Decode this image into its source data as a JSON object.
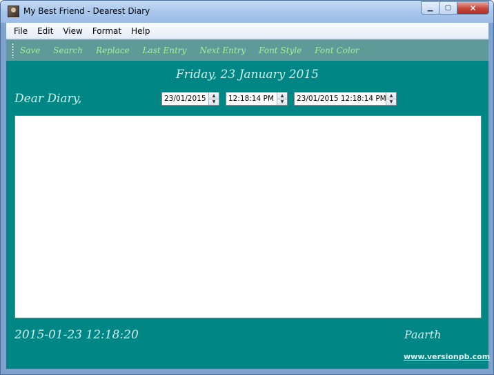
{
  "window": {
    "title": "My Best Friend - Dearest Diary",
    "controls": {
      "minimize": "▁",
      "maximize": "▢",
      "close": "✕"
    }
  },
  "menu": {
    "items": [
      {
        "label": "File"
      },
      {
        "label": "Edit"
      },
      {
        "label": "View"
      },
      {
        "label": "Format"
      },
      {
        "label": "Help"
      }
    ]
  },
  "toolbar": {
    "items": [
      {
        "label": "Save"
      },
      {
        "label": "Search"
      },
      {
        "label": "Replace"
      },
      {
        "label": "Last Entry"
      },
      {
        "label": "Next Entry"
      },
      {
        "label": "Font Style"
      },
      {
        "label": "Font Color"
      }
    ]
  },
  "main": {
    "date_heading": "Friday, 23 January 2015",
    "greeting": "Dear Diary,",
    "date_picker": {
      "value": "23/01/2015"
    },
    "time_picker": {
      "value": "12:18:14 PM"
    },
    "datetime_picker": {
      "value": "23/01/2015 12:18:14 PM"
    },
    "entry_text": "",
    "timestamp": "2015-01-23 12:18:20",
    "author": "Paarth",
    "site_link": "www.versionpb.com"
  },
  "icons": {
    "spin_up": "▲",
    "spin_down": "▼"
  },
  "colors": {
    "accent": "#008785",
    "toolbar_bg": "#5f9a98",
    "toolbar_text": "#a6ef9c",
    "heading_text": "#cfeeea"
  }
}
